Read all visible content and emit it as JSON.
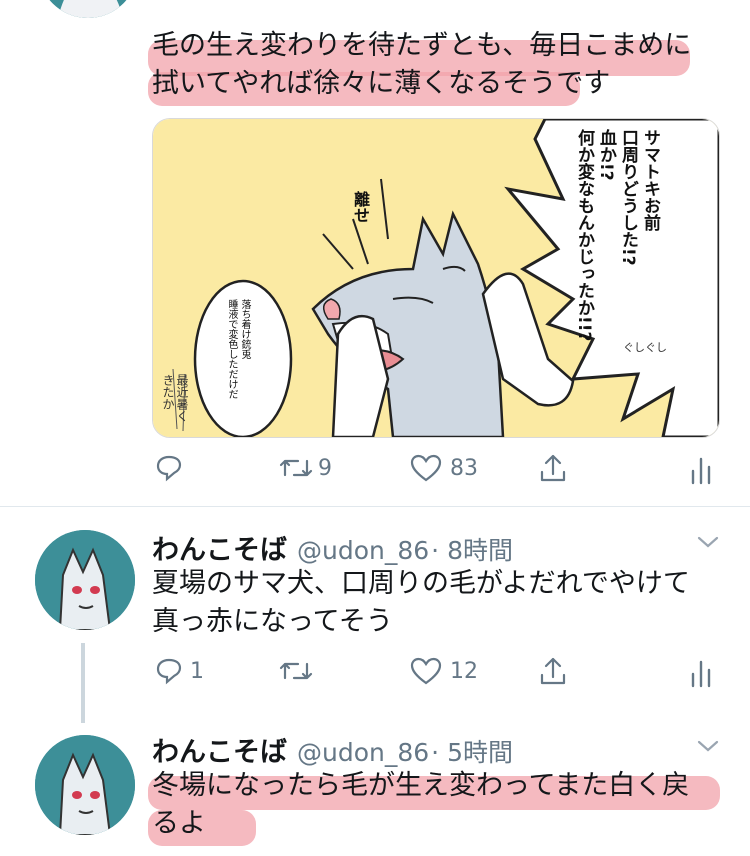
{
  "top_tweet": {
    "line1": "毛の生え変わりを待たずとも、毎日こまめに",
    "line2": "拭いてやれば徐々に薄くなるそうです",
    "image": {
      "bubble_right_lines": [
        "サマトキお前",
        "口周りどうした!?",
        "血か!?",
        "何か変なもんかじったか!!?"
      ],
      "bubble_left_lines": [
        "落ち着け銃兎",
        "睡液で変色しただけだ"
      ],
      "sfx_left": "離せ",
      "side_note": "最近暑く きたか",
      "small_sfx": "ぐしぐし"
    },
    "actions": {
      "reply_count": "",
      "retweet_count": "9",
      "like_count": "83"
    }
  },
  "tweet2": {
    "name": "わんこそば",
    "handle": "@udon_86",
    "time": "· 8時間",
    "line1": "夏場のサマ犬、口周りの毛がよだれでやけて",
    "line2": "真っ赤になってそう",
    "actions": {
      "reply_count": "1",
      "retweet_count": "",
      "like_count": "12"
    }
  },
  "tweet3": {
    "name": "わんこそば",
    "handle": "@udon_86",
    "time": "· 5時間",
    "line1": "冬場になったら毛が生え変わってまた白く戻",
    "line2": "るよ"
  },
  "colors": {
    "highlight": "#f2a3ab",
    "image_bg": "#fbeaa3",
    "avatar_bg": "#3d8f98",
    "icon_gray": "#657786"
  }
}
